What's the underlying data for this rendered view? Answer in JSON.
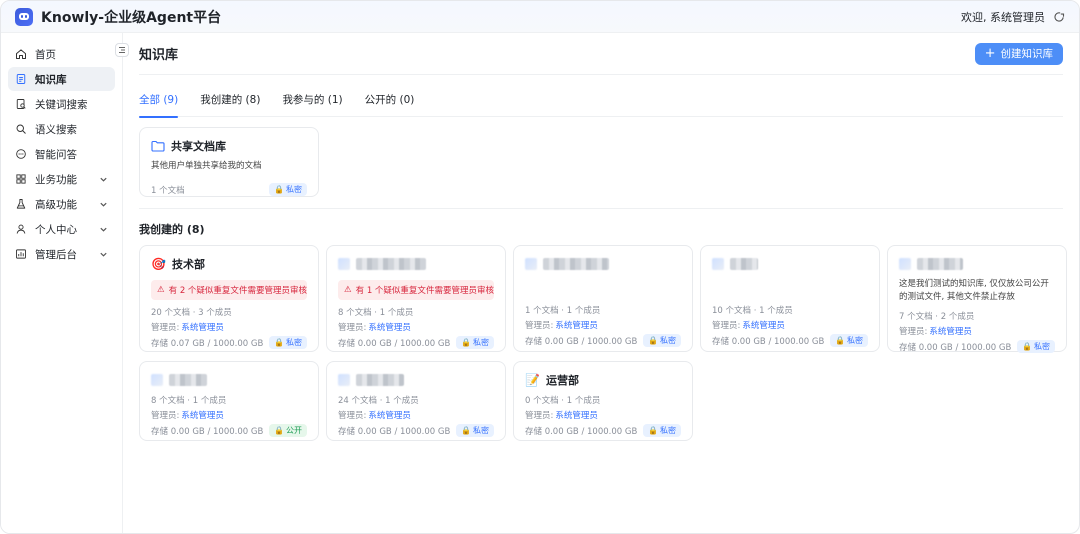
{
  "app": {
    "title": "Knowly-企业级Agent平台"
  },
  "header": {
    "welcome": "欢迎, 系统管理员"
  },
  "sidebar": {
    "items": [
      {
        "label": "首页",
        "icon": "home-icon"
      },
      {
        "label": "知识库",
        "icon": "document-icon",
        "active": true
      },
      {
        "label": "关键词搜索",
        "icon": "keyword-search-icon"
      },
      {
        "label": "语义搜索",
        "icon": "search-icon"
      },
      {
        "label": "智能问答",
        "icon": "chat-icon"
      },
      {
        "label": "业务功能",
        "icon": "grid-icon",
        "expandable": true
      },
      {
        "label": "高级功能",
        "icon": "flask-icon",
        "expandable": true
      },
      {
        "label": "个人中心",
        "icon": "user-icon",
        "expandable": true
      },
      {
        "label": "管理后台",
        "icon": "dashboard-icon",
        "expandable": true
      }
    ]
  },
  "page": {
    "title": "知识库",
    "create_label": "创建知识库",
    "tabs": [
      {
        "label": "全部 (9)",
        "active": true
      },
      {
        "label": "我创建的 (8)"
      },
      {
        "label": "我参与的 (1)"
      },
      {
        "label": "公开的 (0)"
      }
    ],
    "shared": {
      "title": "共享文档库",
      "desc": "其他用户单独共享给我的文档",
      "count": "1 个文档",
      "badge": "私密"
    },
    "created_section": "我创建的 (8)",
    "cards": [
      {
        "title": "技术部",
        "emoji": "🎯",
        "warning": "有 2 个疑似重复文件需要管理员审核",
        "stats": "20 个文档 · 3 个成员",
        "admin_label": "管理员:",
        "admin": "系统管理员",
        "storage": "存储 0.07 GB / 1000.00 GB",
        "badge": "私密",
        "public": false
      },
      {
        "title": "",
        "warning": "有 1 个疑似重复文件需要管理员审核",
        "stats": "8 个文档 · 1 个成员",
        "admin_label": "管理员:",
        "admin": "系统管理员",
        "storage": "存储 0.00 GB / 1000.00 GB",
        "badge": "私密",
        "public": false
      },
      {
        "title": "",
        "stats": "1 个文档 · 1 个成员",
        "admin_label": "管理员:",
        "admin": "系统管理员",
        "storage": "存储 0.00 GB / 1000.00 GB",
        "badge": "私密",
        "public": false
      },
      {
        "title": "",
        "stats": "10 个文档 · 1 个成员",
        "admin_label": "管理员:",
        "admin": "系统管理员",
        "storage": "存储 0.00 GB / 1000.00 GB",
        "badge": "私密",
        "public": false
      },
      {
        "title": "",
        "desc": "这是我们测试的知识库, 仅仅放公司公开的测试文件, 其他文件禁止存放",
        "stats": "7 个文档 · 2 个成员",
        "admin_label": "管理员:",
        "admin": "系统管理员",
        "storage": "存储 0.00 GB / 1000.00 GB",
        "badge": "私密",
        "public": false
      },
      {
        "title": "",
        "stats": "8 个文档 · 1 个成员",
        "admin_label": "管理员:",
        "admin": "系统管理员",
        "storage": "存储 0.00 GB / 1000.00 GB",
        "badge": "公开",
        "public": true
      },
      {
        "title": "",
        "stats": "24 个文档 · 1 个成员",
        "admin_label": "管理员:",
        "admin": "系统管理员",
        "storage": "存储 0.00 GB / 1000.00 GB",
        "badge": "私密",
        "public": false
      },
      {
        "title": "运营部",
        "emoji": "📝",
        "stats": "0 个文档 · 1 个成员",
        "admin_label": "管理员:",
        "admin": "系统管理员",
        "storage": "存储 0.00 GB / 1000.00 GB",
        "badge": "私密",
        "public": false
      }
    ]
  }
}
